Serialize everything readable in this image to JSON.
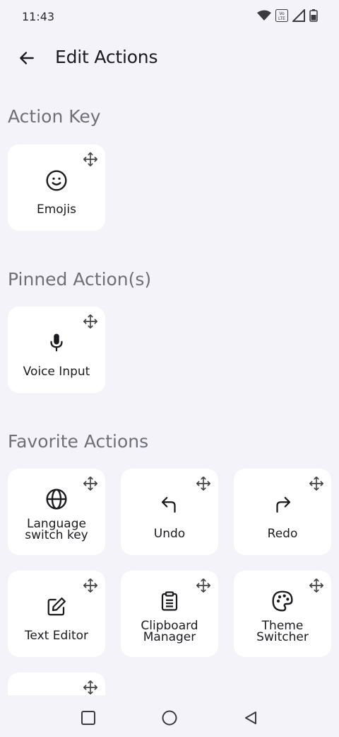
{
  "status_bar": {
    "time": "11:43",
    "icons": [
      "wifi-icon",
      "volte-icon",
      "signal-icon",
      "battery-icon"
    ],
    "volte_text": "Vo LTE"
  },
  "app_bar": {
    "back_icon": "arrow-left-icon",
    "title": "Edit Actions"
  },
  "sections": {
    "action_key": {
      "title": "Action Key"
    },
    "pinned": {
      "title": "Pinned Action(s)"
    },
    "favorites": {
      "title": "Favorite Actions"
    }
  },
  "action_key": {
    "label": "Emojis",
    "icon": "emoji-icon"
  },
  "pinned_actions": [
    {
      "label": "Voice Input",
      "icon": "microphone-icon"
    }
  ],
  "favorite_actions": [
    {
      "label": "Language switch key",
      "icon": "globe-icon"
    },
    {
      "label": "Undo",
      "icon": "undo-icon"
    },
    {
      "label": "Redo",
      "icon": "redo-icon"
    },
    {
      "label": "Text Editor",
      "icon": "edit-icon"
    },
    {
      "label": "Clipboard Manager",
      "icon": "clipboard-icon"
    },
    {
      "label": "Theme Switcher",
      "icon": "palette-icon"
    }
  ],
  "nav_bar": {
    "icons": [
      "recents-square-icon",
      "home-circle-icon",
      "back-triangle-icon"
    ]
  },
  "colors": {
    "background": "#f4f3fa",
    "card": "#ffffff",
    "section_title": "#6f6f78",
    "text": "#1b1b1f"
  }
}
